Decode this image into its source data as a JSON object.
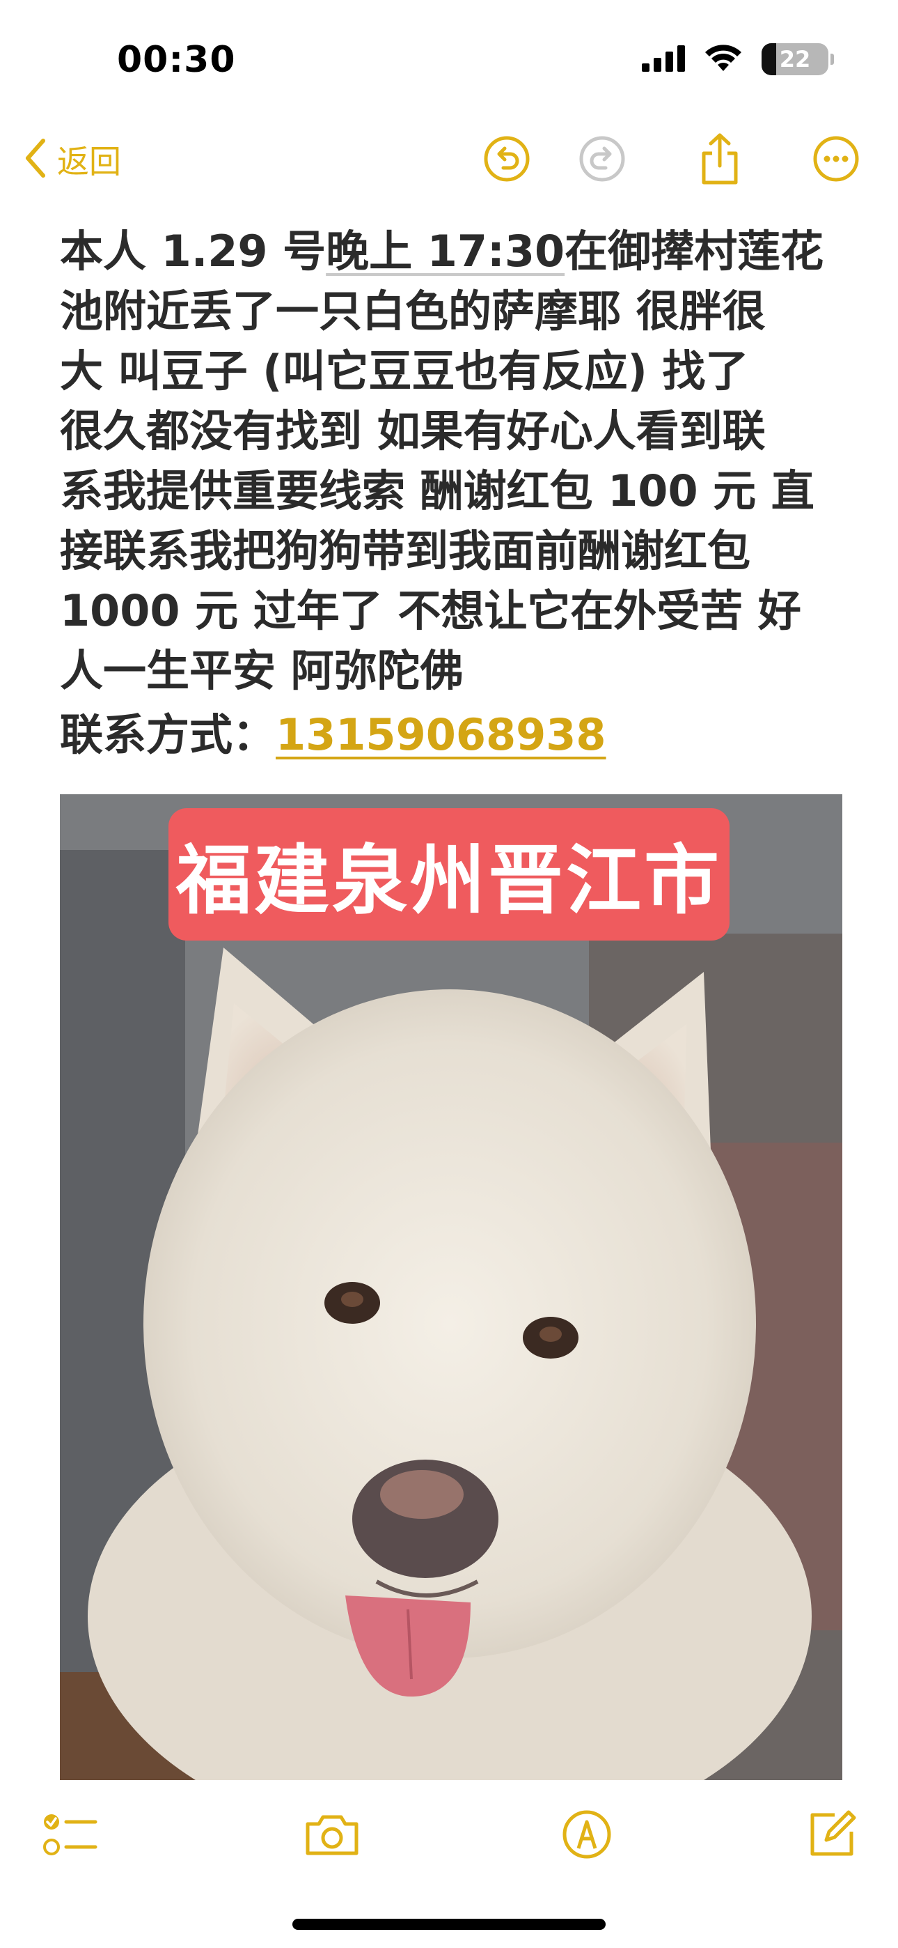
{
  "status_bar": {
    "time": "00:30",
    "battery_level": "22",
    "battery_fraction": 0.22
  },
  "nav": {
    "back_label": "返回"
  },
  "note": {
    "segments": [
      {
        "text": "本人 1.29 号"
      },
      {
        "text": "晚上 17:30",
        "style": "underlined"
      },
      {
        "text": "在御撵村莲花"
      }
    ],
    "lines": [
      "池附近丢了一只白色的萨摩耶 很胖很",
      "大 叫豆子 (叫它豆豆也有反应) 找了",
      "很久都没有找到 如果有好心人看到联",
      "系我提供重要线索 酬谢红包 100 元 直",
      "接联系我把狗狗带到我面前酬谢红包",
      "1000 元 过年了 不想让它在外受苦 好",
      "人一生平安 阿弥陀佛"
    ],
    "contact_label": "联系方式：",
    "phone": "13159068938"
  },
  "photo": {
    "tag_text": "福建泉州晋江市"
  },
  "colors": {
    "accent": "#e1b215",
    "link": "#d4a514",
    "tag_bg": "#ef5b5e",
    "text": "#2b2b2b"
  },
  "toolbar": {
    "icons": [
      "checklist-icon",
      "camera-icon",
      "markup-pen-icon",
      "compose-icon"
    ]
  }
}
